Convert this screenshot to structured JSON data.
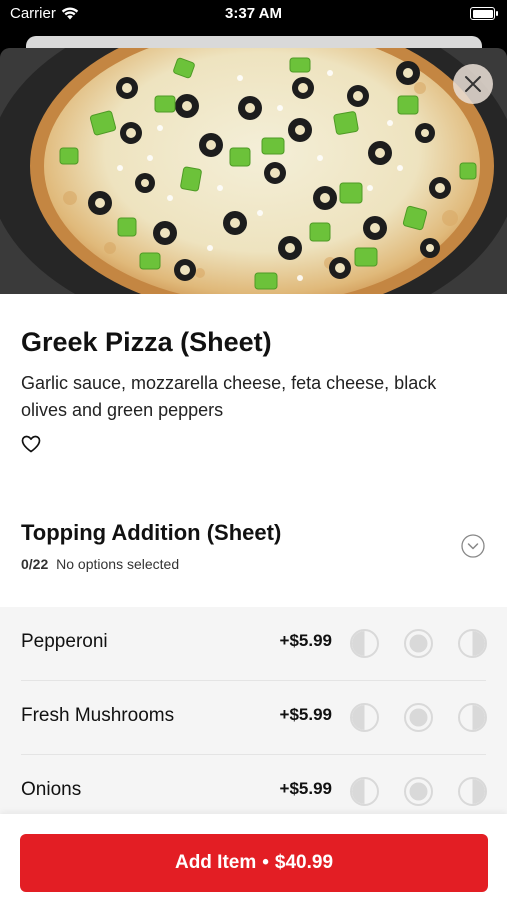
{
  "status": {
    "carrier": "Carrier",
    "time": "3:37 AM",
    "icons": [
      "wifi-icon",
      "battery-icon"
    ]
  },
  "product": {
    "image_alt": "Greek Pizza",
    "title": "Greek Pizza (Sheet)",
    "description": "Garlic sauce, mozzarella cheese, feta cheese, black olives and green peppers",
    "favorite_icon": "heart-icon"
  },
  "modifier_group": {
    "title": "Topping Addition (Sheet)",
    "count": "0/22",
    "status": "No options selected",
    "toggle_icon": "chevron-down-icon"
  },
  "options": [
    {
      "name": "Pepperoni",
      "price": "+$5.99"
    },
    {
      "name": "Fresh Mushrooms",
      "price": "+$5.99"
    },
    {
      "name": "Onions",
      "price": "+$5.99"
    }
  ],
  "portion_icons": [
    "left-half-icon",
    "whole-icon",
    "right-half-icon"
  ],
  "footer": {
    "button_label": "Add Item",
    "separator": "•",
    "total": "$40.99"
  },
  "colors": {
    "accent": "#e31e24",
    "options_bg": "#f5f5f5",
    "portion_gray": "#d9d9d9"
  }
}
